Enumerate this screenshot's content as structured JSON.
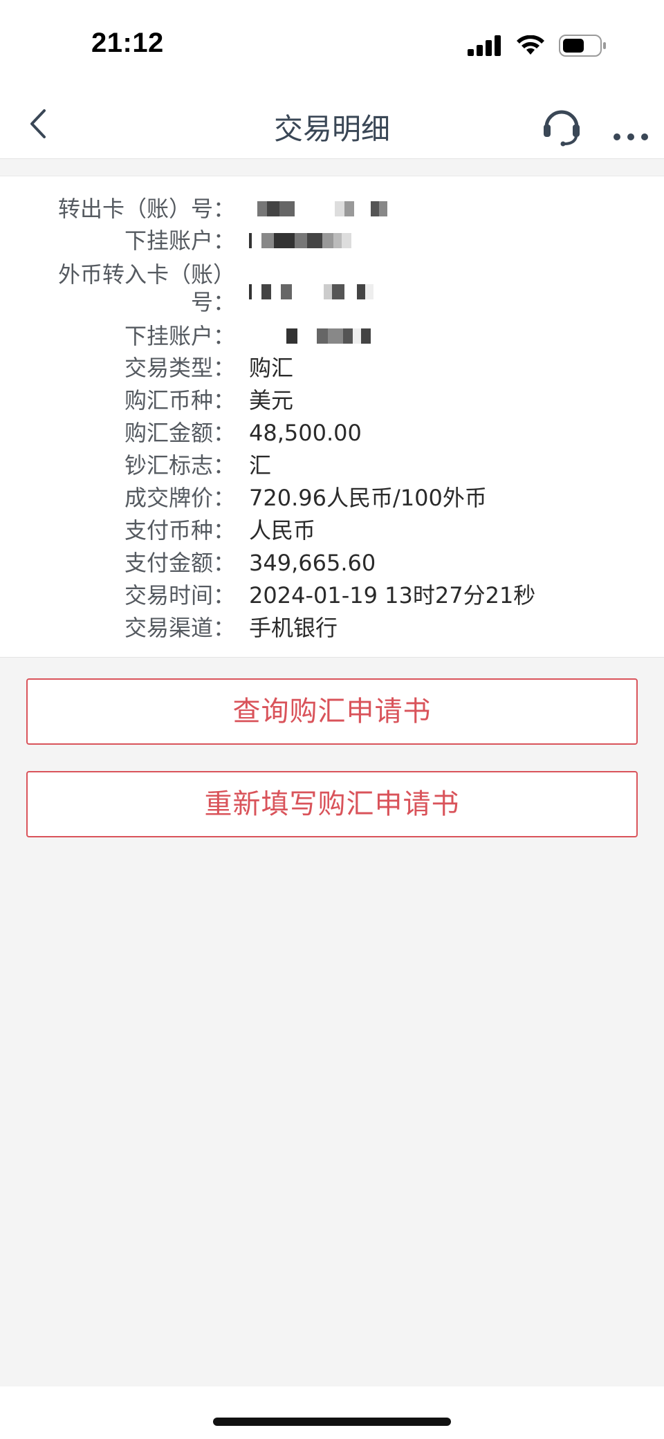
{
  "status_bar": {
    "time": "21:12",
    "icons": [
      "signal-icon",
      "wifi-icon",
      "battery-icon"
    ]
  },
  "nav": {
    "title": "交易明细",
    "back_icon": "chevron-left-icon",
    "service_icon": "headset-icon",
    "more_icon": "more-horizontal-icon"
  },
  "details": {
    "rows": [
      {
        "label": "转出卡（账）号：",
        "value": "",
        "masked": true
      },
      {
        "label": "下挂账户：",
        "value": "",
        "masked": true
      },
      {
        "label": "外币转入卡（账）号：",
        "value": "",
        "masked": true
      },
      {
        "label": "下挂账户：",
        "value": "",
        "masked": true
      },
      {
        "label": "交易类型：",
        "value": "购汇"
      },
      {
        "label": "购汇币种：",
        "value": "美元"
      },
      {
        "label": "购汇金额：",
        "value": "48,500.00"
      },
      {
        "label": "钞汇标志：",
        "value": "汇"
      },
      {
        "label": "成交牌价：",
        "value": "720.96人民币/100外币"
      },
      {
        "label": "支付币种：",
        "value": "人民币"
      },
      {
        "label": "支付金额：",
        "value": "349,665.60"
      },
      {
        "label": "交易时间：",
        "value": "2024-01-19 13时27分21秒"
      },
      {
        "label": "交易渠道：",
        "value": "手机银行"
      }
    ],
    "row3_label_line1": "外币转入卡（账）",
    "row3_label_line2": "号："
  },
  "actions": {
    "query_button": "查询购汇申请书",
    "refill_button": "重新填写购汇申请书"
  },
  "colors": {
    "accent": "#d9535a",
    "title": "#3a4756",
    "label": "#555a60",
    "value": "#2a2a2a",
    "background": "#f4f4f4"
  }
}
